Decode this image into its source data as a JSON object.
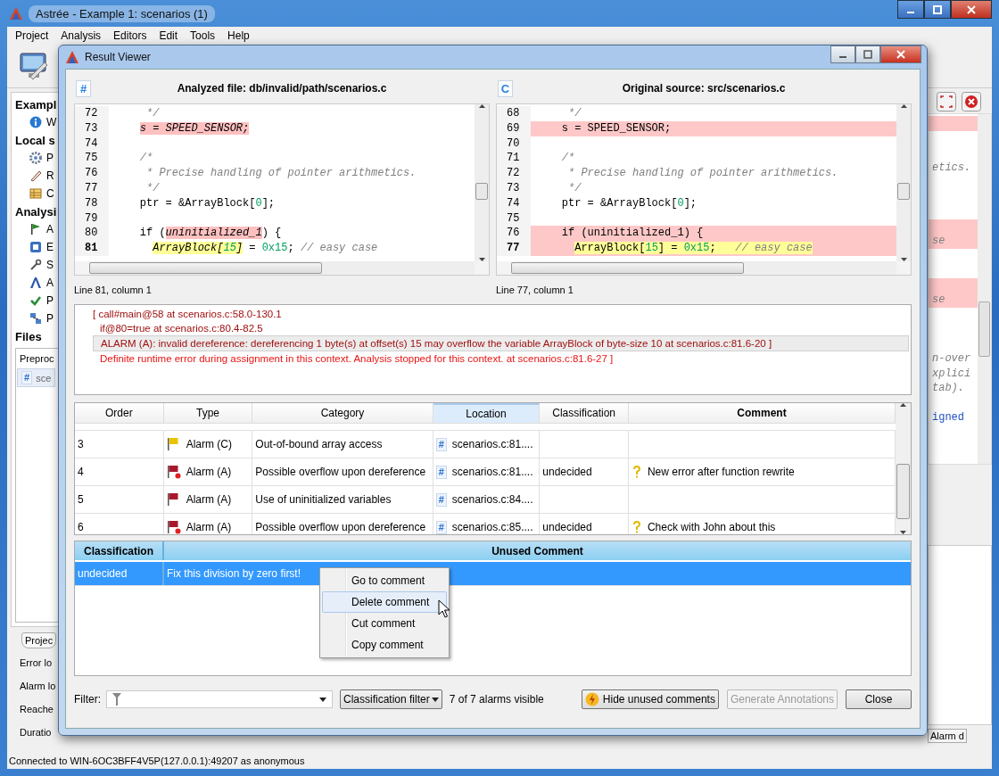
{
  "main_window": {
    "title": "Astrée - Example 1: scenarios (1)",
    "menu": [
      "Project",
      "Analysis",
      "Editors",
      "Edit",
      "Tools",
      "Help"
    ],
    "sidebar": [
      {
        "kind": "heading",
        "label": "Exampl"
      },
      {
        "kind": "info",
        "label": "W"
      },
      {
        "kind": "heading",
        "label": "Local s"
      },
      {
        "kind": "gear",
        "label": "P"
      },
      {
        "kind": "pencil",
        "label": "R"
      },
      {
        "kind": "table",
        "label": "C"
      },
      {
        "kind": "heading",
        "label": "Analysi"
      },
      {
        "kind": "flag",
        "label": "A"
      },
      {
        "kind": "square",
        "label": "E"
      },
      {
        "kind": "wrench",
        "label": "S"
      },
      {
        "kind": "letter",
        "label": "A"
      },
      {
        "kind": "check",
        "label": "P"
      },
      {
        "kind": "network",
        "label": "P"
      },
      {
        "kind": "heading",
        "label": "Files"
      }
    ],
    "files_tab": "Preproc",
    "files": [
      {
        "badge": "#",
        "label": "sce"
      }
    ],
    "project_tab": "Projec",
    "stats": [
      "Error lo",
      "Alarm lo",
      "Reache",
      "Duratio"
    ],
    "right_code": [
      {
        "highlighted": true
      },
      {
        "highlighted": false
      },
      {
        "highlighted": false
      },
      {
        "highlighted": false,
        "kind": "comment",
        "text": "etics."
      },
      {
        "highlighted": false
      },
      {
        "highlighted": false
      },
      {
        "highlighted": false
      },
      {
        "highlighted": true
      },
      {
        "highlighted": true,
        "kind": "comment",
        "text": "se"
      },
      {
        "highlighted": false
      },
      {
        "highlighted": false
      },
      {
        "highlighted": true
      },
      {
        "highlighted": true,
        "kind": "comment",
        "text": "se"
      },
      {
        "highlighted": false
      },
      {
        "highlighted": false
      },
      {
        "highlighted": false
      },
      {
        "highlighted": false,
        "kind": "comment",
        "text": "n-over"
      },
      {
        "highlighted": false,
        "kind": "comment",
        "text": "xplici"
      },
      {
        "highlighted": false,
        "kind": "comment",
        "text": "tab)."
      },
      {
        "highlighted": false
      },
      {
        "highlighted": false,
        "kind": "keyword",
        "text": "igned"
      }
    ],
    "bottom_tab": "Alarm d",
    "status": "Connected to WIN-6OC3BFF4V5P(127.0.0.1):49207 as anonymous"
  },
  "result_viewer": {
    "title": "Result Viewer",
    "panes": [
      {
        "badge": "#",
        "title": "Analyzed file: db/invalid/path/scenarios.c",
        "italic_marks": true,
        "position": "Line 81, column 1",
        "lines": [
          {
            "number": "72",
            "current": false,
            "highlighted": false,
            "spans": [
              {
                "text": "     */",
                "kind": "comment",
                "marked": false
              }
            ]
          },
          {
            "number": "73",
            "current": false,
            "highlighted": false,
            "spans": [
              {
                "text": "    s = SPEED_SENSOR;",
                "kind": "code",
                "marked": true
              }
            ]
          },
          {
            "number": "74",
            "current": false,
            "highlighted": false
          },
          {
            "number": "75",
            "current": false,
            "highlighted": false,
            "spans": [
              {
                "text": "    /*",
                "kind": "comment",
                "marked": false
              }
            ]
          },
          {
            "number": "76",
            "current": false,
            "highlighted": false,
            "spans": [
              {
                "text": "     * Precise handling of pointer arithmetics.",
                "kind": "comment",
                "marked": false
              }
            ]
          },
          {
            "number": "77",
            "current": false,
            "highlighted": false,
            "spans": [
              {
                "text": "     */",
                "kind": "comment",
                "marked": false
              }
            ]
          },
          {
            "number": "78",
            "current": false,
            "highlighted": false,
            "spans": [
              {
                "text": "    ptr = &ArrayBlock[",
                "kind": "code",
                "marked": false
              },
              {
                "text": "0",
                "kind": "number",
                "marked": false
              },
              {
                "text": "];",
                "kind": "code",
                "marked": false
              }
            ]
          },
          {
            "number": "79",
            "current": false,
            "highlighted": false
          },
          {
            "number": "80",
            "current": false,
            "highlighted": false,
            "spans": [
              {
                "text": "    if (",
                "kind": "code",
                "marked": false
              },
              {
                "text": "uninitialized_1",
                "kind": "code",
                "marked": true
              },
              {
                "text": ") {",
                "kind": "code",
                "marked": false
              }
            ]
          },
          {
            "number": "81",
            "current": true,
            "highlighted": false,
            "spans": [
              {
                "text": "      ArrayBlock[",
                "kind": "code",
                "marked": true
              },
              {
                "text": "15",
                "kind": "number",
                "marked": true
              },
              {
                "text": "]",
                "kind": "code",
                "marked": true
              },
              {
                "text": " = ",
                "kind": "code",
                "marked": false
              },
              {
                "text": "0x15",
                "kind": "number",
                "marked": false
              },
              {
                "text": "; ",
                "kind": "code",
                "marked": false
              },
              {
                "text": "// easy case",
                "kind": "comment",
                "marked": false
              }
            ]
          }
        ]
      },
      {
        "badge": "C",
        "title": "Original source: src/scenarios.c",
        "italic_marks": false,
        "position": "Line 77, column 1",
        "lines": [
          {
            "number": "68",
            "current": false,
            "highlighted": false,
            "spans": [
              {
                "text": "     */",
                "kind": "comment",
                "marked": false
              }
            ]
          },
          {
            "number": "69",
            "current": false,
            "highlighted": true,
            "spans": [
              {
                "text": "    s = SPEED_SENSOR;",
                "kind": "code",
                "marked": false
              }
            ]
          },
          {
            "number": "70",
            "current": false,
            "highlighted": false
          },
          {
            "number": "71",
            "current": false,
            "highlighted": false,
            "spans": [
              {
                "text": "    /*",
                "kind": "comment",
                "marked": false
              }
            ]
          },
          {
            "number": "72",
            "current": false,
            "highlighted": false,
            "spans": [
              {
                "text": "     * Precise handling of pointer arithmetics.",
                "kind": "comment",
                "marked": false
              }
            ]
          },
          {
            "number": "73",
            "current": false,
            "highlighted": false,
            "spans": [
              {
                "text": "     */",
                "kind": "comment",
                "marked": false
              }
            ]
          },
          {
            "number": "74",
            "current": false,
            "highlighted": false,
            "spans": [
              {
                "text": "    ptr = &ArrayBlock[",
                "kind": "code",
                "marked": false
              },
              {
                "text": "0",
                "kind": "number",
                "marked": false
              },
              {
                "text": "];",
                "kind": "code",
                "marked": false
              }
            ]
          },
          {
            "number": "75",
            "current": false,
            "highlighted": false
          },
          {
            "number": "76",
            "current": false,
            "highlighted": true,
            "spans": [
              {
                "text": "    if (uninitialized_1) {",
                "kind": "code",
                "marked": false
              }
            ]
          },
          {
            "number": "77",
            "current": true,
            "highlighted": true,
            "spans": [
              {
                "text": "      ArrayBlock[",
                "kind": "code",
                "marked": true
              },
              {
                "text": "15",
                "kind": "number",
                "marked": true
              },
              {
                "text": "] = ",
                "kind": "code",
                "marked": true
              },
              {
                "text": "0x15",
                "kind": "number",
                "marked": true
              },
              {
                "text": ";   ",
                "kind": "code",
                "marked": true
              },
              {
                "text": "// easy case",
                "kind": "comment",
                "marked": true
              }
            ]
          }
        ]
      }
    ],
    "messages": [
      {
        "kind": "call",
        "text": "[ call#main@58 at scenarios.c:58.0-130.1",
        "selected": false
      },
      {
        "kind": "context",
        "text": "if@80=true at scenarios.c:80.4-82.5",
        "selected": false
      },
      {
        "kind": "alarm",
        "text": "ALARM (A): invalid dereference: dereferencing 1 byte(s) at offset(s) 15 may overflow the variable ArrayBlock of byte-size 10 at scenarios.c:81.6-20 ]",
        "selected": true
      },
      {
        "kind": "error",
        "text": "Definite runtime error during assignment in this context. Analysis stopped for this context. at scenarios.c:81.6-27 ]",
        "selected": false
      }
    ],
    "alarm_table": {
      "columns": [
        {
          "label": "Order",
          "sorted": false,
          "bold": false
        },
        {
          "label": "Type",
          "sorted": false,
          "bold": false
        },
        {
          "label": "Category",
          "sorted": false,
          "bold": false
        },
        {
          "label": "Location",
          "sorted": true,
          "bold": false
        },
        {
          "label": "Classification",
          "sorted": false,
          "bold": false
        },
        {
          "label": "Comment",
          "sorted": false,
          "bold": true
        }
      ],
      "rows": [
        {
          "order": "3",
          "type": "Alarm (C)",
          "color": "#e8c400",
          "dot": false,
          "category": "Out-of-bound array access",
          "location_badge": "#",
          "location": "scenarios.c:81...."
        },
        {
          "order": "4",
          "type": "Alarm (A)",
          "color": "#a8182c",
          "dot": true,
          "category": "Possible overflow upon dereference",
          "location_badge": "#",
          "location": "scenarios.c:81....",
          "classification": "undecided",
          "comment": "New error after function rewrite"
        },
        {
          "order": "5",
          "type": "Alarm (A)",
          "color": "#a8182c",
          "dot": false,
          "category": "Use of uninitialized variables",
          "location_badge": "#",
          "location": "scenarios.c:84...."
        },
        {
          "order": "6",
          "type": "Alarm (A)",
          "color": "#a8182c",
          "dot": true,
          "category": "Possible overflow upon dereference",
          "location_badge": "#",
          "location": "scenarios.c:85....",
          "classification": "undecided",
          "comment": "Check with John about this"
        }
      ]
    },
    "unused_table": {
      "columns": [
        "Classification",
        "Unused Comment"
      ],
      "rows": [
        {
          "classification": "undecided",
          "comment": "Fix this division by zero first!",
          "selected": true
        }
      ]
    },
    "context_menu": [
      {
        "label": "Go to comment",
        "selected": false
      },
      {
        "label": "Delete comment",
        "selected": true
      },
      {
        "label": "Cut comment",
        "selected": false
      },
      {
        "label": "Copy comment",
        "selected": false
      }
    ],
    "filter_label": "Filter:",
    "classification_filter": "Classification filter",
    "count": "7 of 7 alarms visible",
    "buttons": [
      {
        "label": "Hide unused comments",
        "kind": "hide",
        "disabled": false
      },
      {
        "label": "Generate Annotations",
        "kind": "plain",
        "disabled": true
      },
      {
        "label": "Close",
        "kind": "plain",
        "disabled": false
      }
    ]
  }
}
